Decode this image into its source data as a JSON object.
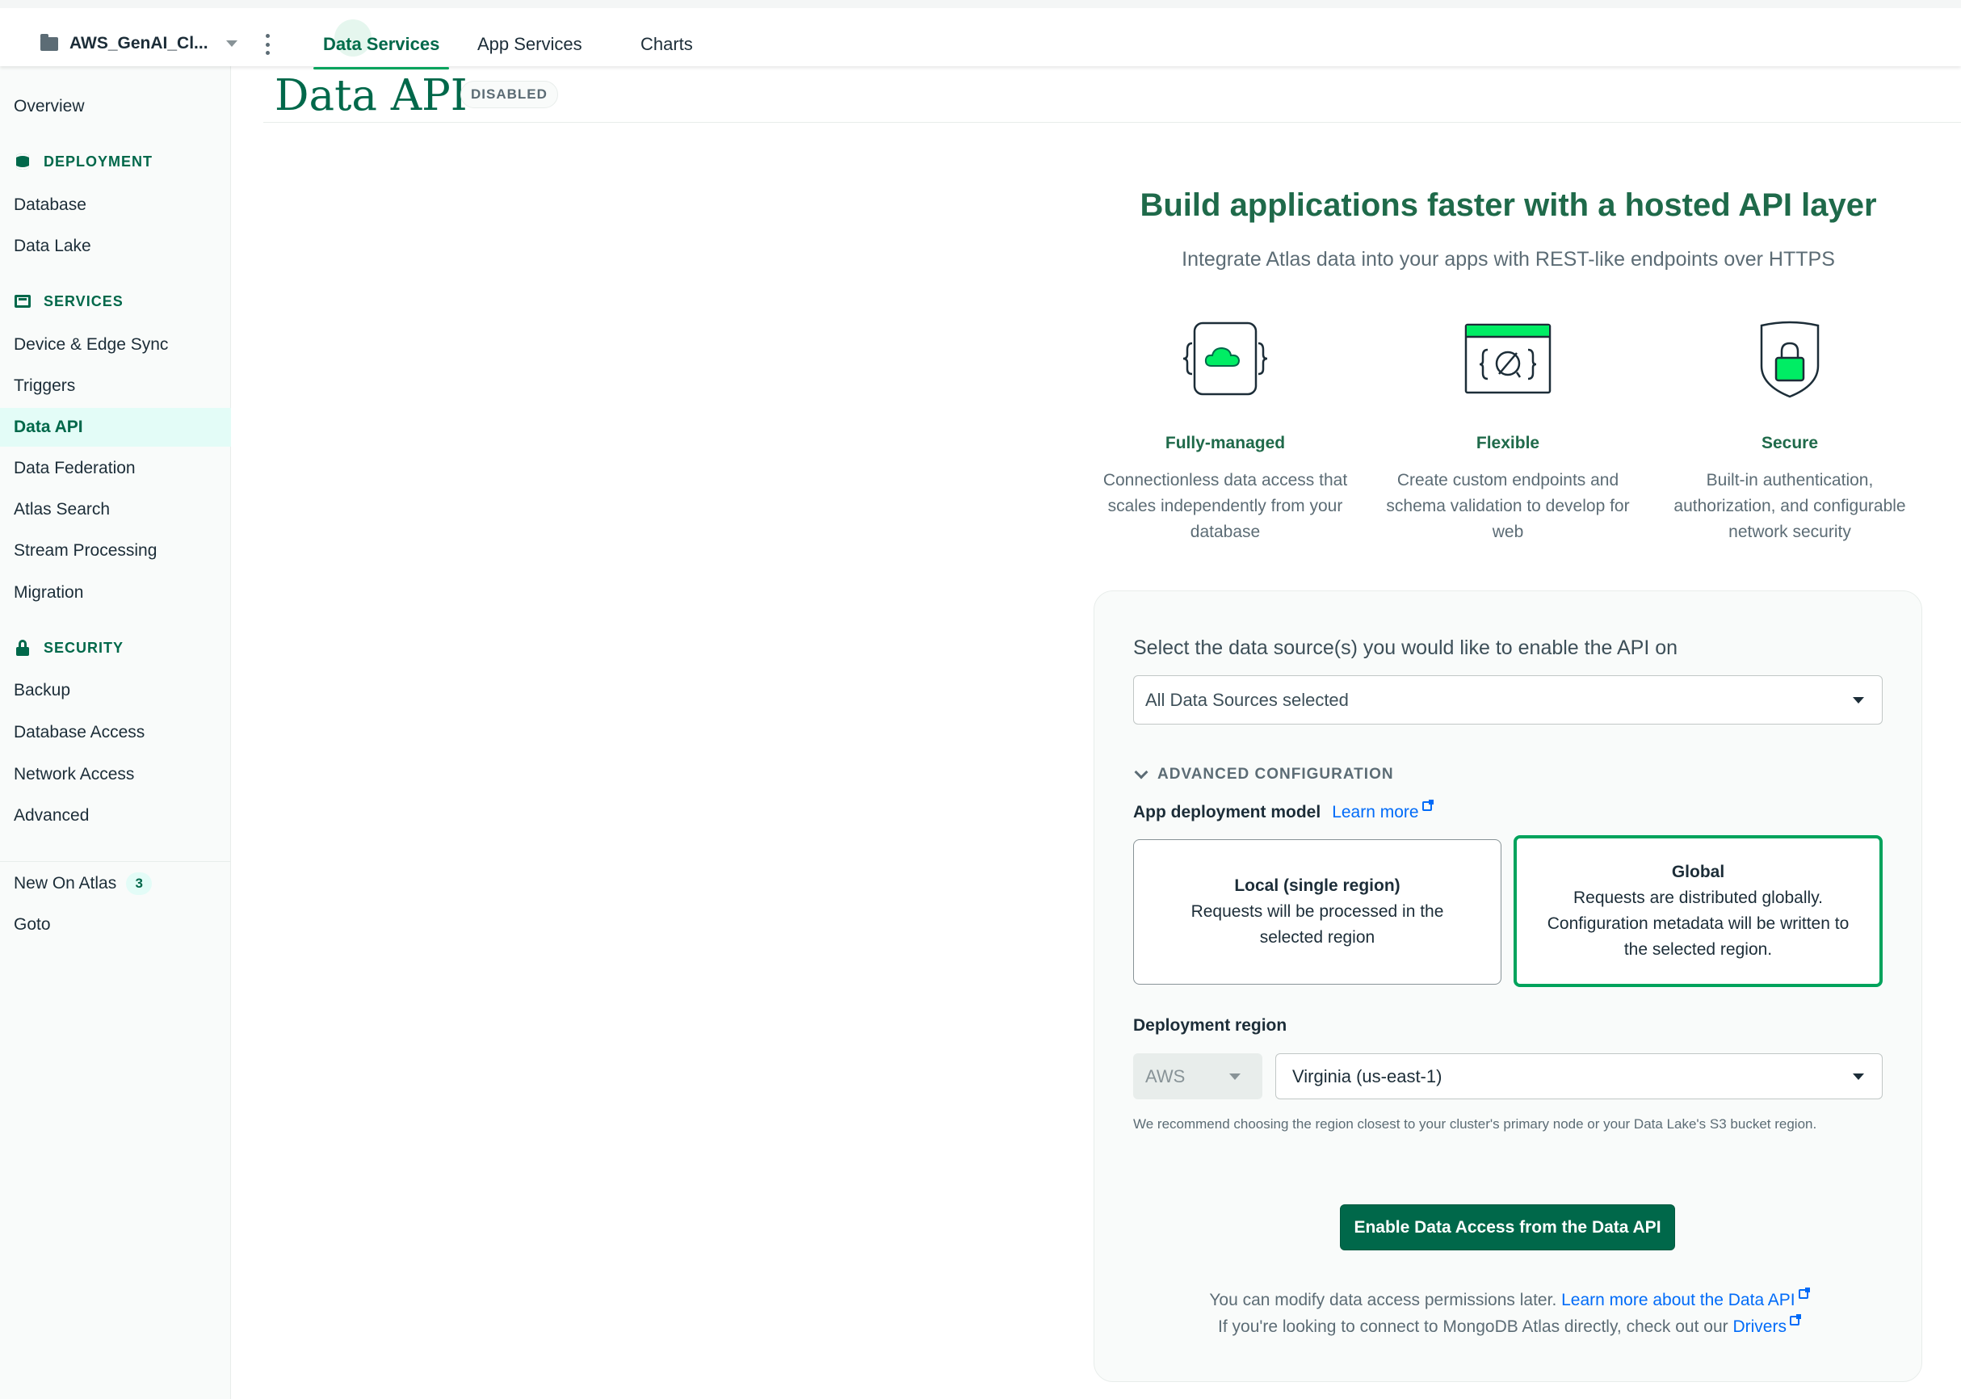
{
  "topbar": {
    "project_name": "AWS_GenAI_Cl...",
    "tabs": [
      {
        "label": "Data Services"
      },
      {
        "label": "App Services"
      },
      {
        "label": "Charts"
      }
    ]
  },
  "sidebar": {
    "overview": "Overview",
    "deployment": {
      "title": "DEPLOYMENT",
      "items": [
        "Database",
        "Data Lake"
      ]
    },
    "services": {
      "title": "SERVICES",
      "items": [
        "Device & Edge Sync",
        "Triggers",
        "Data API",
        "Data Federation",
        "Atlas Search",
        "Stream Processing",
        "Migration"
      ]
    },
    "security": {
      "title": "SECURITY",
      "items": [
        "Backup",
        "Database Access",
        "Network Access",
        "Advanced"
      ]
    },
    "footer": {
      "new_on_atlas": "New On Atlas",
      "new_count": "3",
      "goto": "Goto"
    },
    "active_item": "Data API"
  },
  "page": {
    "title": "Data API",
    "status": "DISABLED"
  },
  "hero": {
    "title": "Build applications faster with a hosted API layer",
    "subtitle": "Integrate Atlas data into your apps with REST-like endpoints over HTTPS",
    "features": [
      {
        "title": "Fully-managed",
        "desc": "Connectionless data access that scales independently from your database",
        "icon": "cloud-braces-icon"
      },
      {
        "title": "Flexible",
        "desc": "Create custom endpoints and schema validation to develop for web",
        "icon": "plug-window-icon"
      },
      {
        "title": "Secure",
        "desc": "Built-in authentication, authorization, and configurable network security",
        "icon": "shield-lock-icon"
      }
    ]
  },
  "config": {
    "data_source_label": "Select the data source(s) you would like to enable the API on",
    "data_source_value": "All Data Sources selected",
    "advanced_title": "ADVANCED CONFIGURATION",
    "model_label": "App deployment model",
    "learn_more": "Learn more",
    "local": {
      "title": "Local (single region)",
      "desc": "Requests will be processed in the selected region"
    },
    "global": {
      "title": "Global",
      "desc": "Requests are distributed globally. Configuration metadata will be written to the selected region."
    },
    "selected_model": "Global",
    "region_label": "Deployment region",
    "provider": "AWS",
    "region": "Virginia (us-east-1)",
    "hint": "We recommend choosing the region closest to your cluster's primary node or your Data Lake's S3 bucket region.",
    "enable_button": "Enable Data Access from the Data API",
    "footer_line1": "You can modify data access permissions later.",
    "footer_link1": "Learn more about the Data API",
    "footer_line2": "If you're looking to connect to MongoDB Atlas directly, check out our",
    "footer_link2": "Drivers"
  },
  "colors": {
    "brand_green": "#00684a",
    "accent_green": "#00a35c",
    "link_blue": "#016bf8"
  }
}
